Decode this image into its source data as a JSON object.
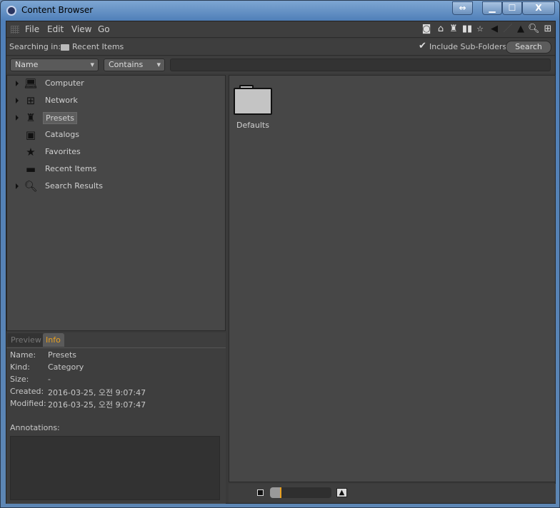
{
  "window": {
    "title": "Content Browser",
    "buttons": {
      "resize": "⇔",
      "minimize": "▁",
      "maximize": "☐",
      "close": "X"
    }
  },
  "menu": {
    "items": [
      "File",
      "Edit",
      "View",
      "Go"
    ]
  },
  "toolbar": {
    "icons": [
      "sphere-icon",
      "home-icon",
      "presets-icon",
      "catalog-icon",
      "favorites-icon",
      "back-icon",
      "forward-icon",
      "up-icon",
      "search-icon",
      "new-icon"
    ]
  },
  "search_bar": {
    "label": "Searching in:",
    "location": "Recent Items",
    "include_subfolders_label": "Include Sub-Folders",
    "include_subfolders_checked": true,
    "search_button": "Search"
  },
  "filter": {
    "field": "Name",
    "operator": "Contains",
    "value": ""
  },
  "tree": [
    {
      "label": "Computer",
      "icon": "computer-icon",
      "expandable": true
    },
    {
      "label": "Network",
      "icon": "network-icon",
      "expandable": true
    },
    {
      "label": "Presets",
      "icon": "presets-icon",
      "expandable": true,
      "selected": true
    },
    {
      "label": "Catalogs",
      "icon": "catalog-icon",
      "expandable": false
    },
    {
      "label": "Favorites",
      "icon": "star-icon",
      "expandable": false
    },
    {
      "label": "Recent Items",
      "icon": "folder-icon",
      "expandable": false
    },
    {
      "label": "Search Results",
      "icon": "search-results-icon",
      "expandable": true
    }
  ],
  "tabs": [
    {
      "label": "Preview",
      "active": false
    },
    {
      "label": "Info",
      "active": true
    }
  ],
  "info": {
    "rows": [
      {
        "k": "Name:",
        "v": "Presets"
      },
      {
        "k": "Kind:",
        "v": "Category"
      },
      {
        "k": "Size:",
        "v": "-"
      },
      {
        "k": "Created:",
        "v": "2016-03-25, 오전 9:07:47"
      },
      {
        "k": "Modified:",
        "v": "2016-03-25, 오전 9:07:47"
      }
    ],
    "annotations_label": "Annotations:",
    "annotations": ""
  },
  "content": {
    "items": [
      {
        "label": "Defaults",
        "icon": "folder-icon"
      }
    ]
  },
  "zoom_slider": {
    "value": 0.05
  },
  "colors": {
    "accent": "#e8a020",
    "title_bar": "#5d86b4"
  }
}
